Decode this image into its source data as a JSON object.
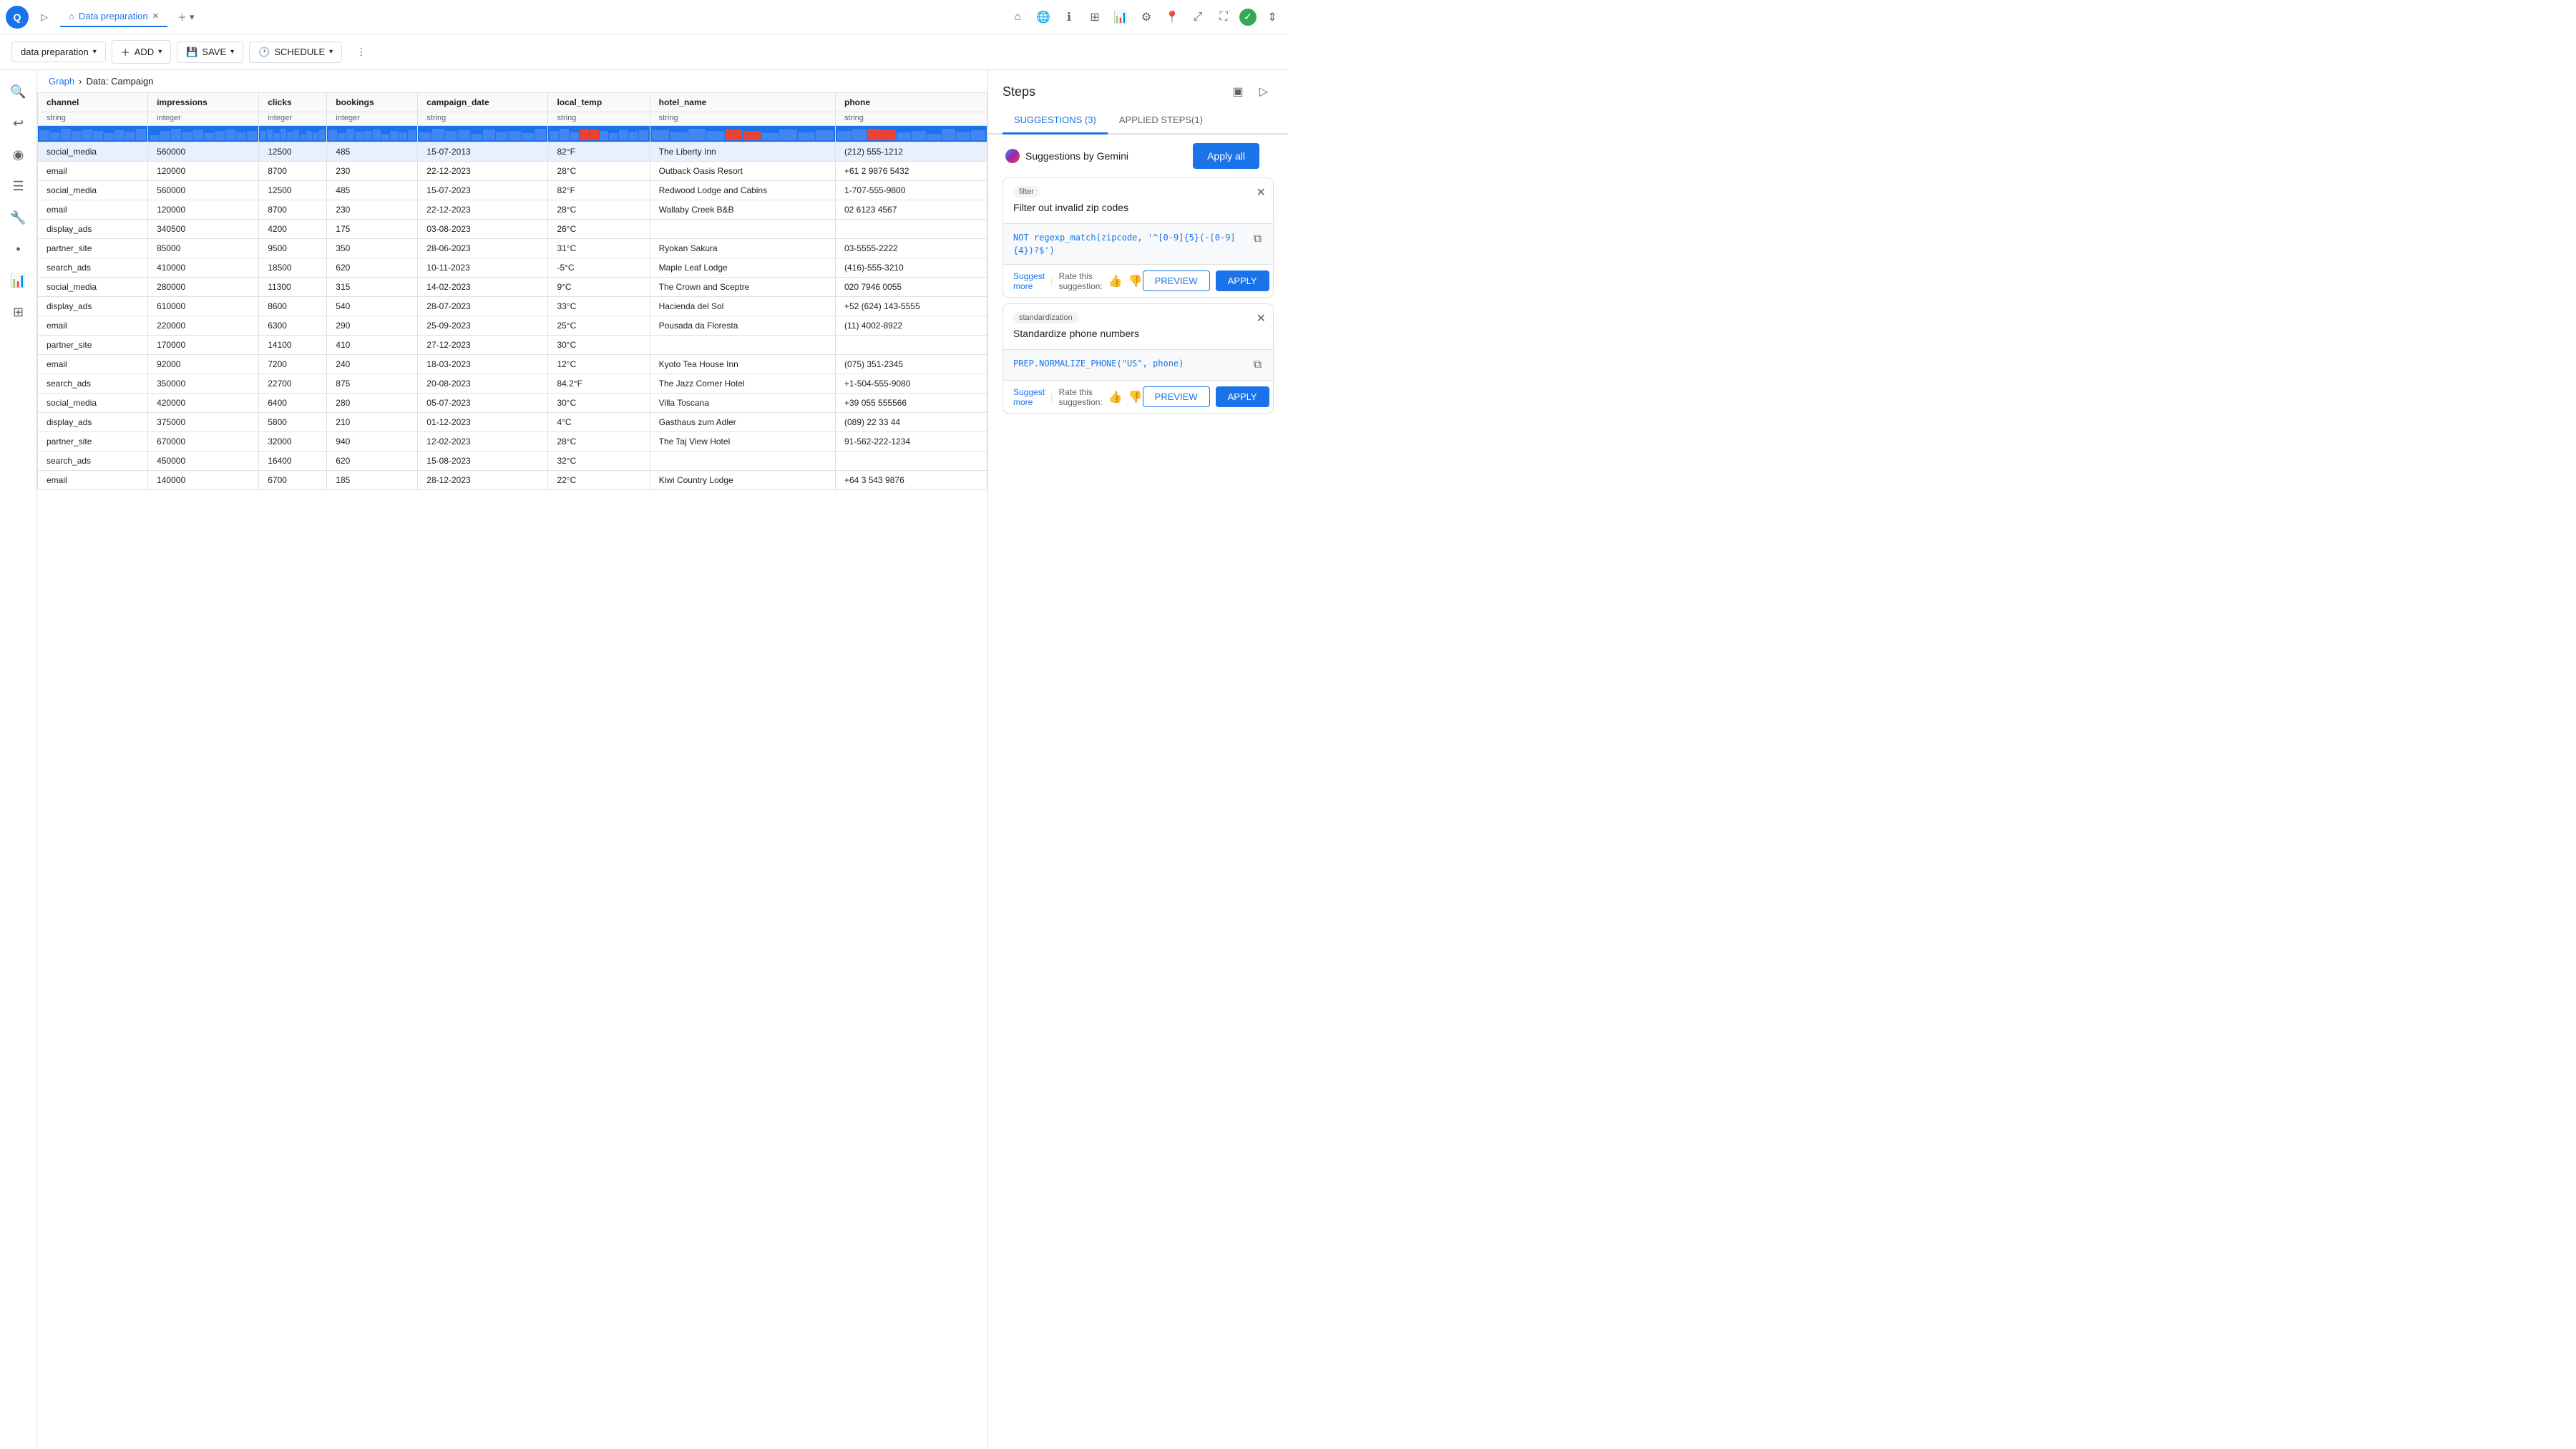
{
  "app": {
    "logo_text": "Q",
    "tab_label": "Data preparation",
    "add_btn": "ADD",
    "save_btn": "SAVE",
    "schedule_btn": "SCHEDULE"
  },
  "breadcrumb": {
    "graph": "Graph",
    "separator": "›",
    "current": "Data: Campaign"
  },
  "table": {
    "columns": [
      {
        "name": "channel",
        "type": "string"
      },
      {
        "name": "impressions",
        "type": "integer"
      },
      {
        "name": "clicks",
        "type": "integer"
      },
      {
        "name": "bookings",
        "type": "integer"
      },
      {
        "name": "campaign_date",
        "type": "string"
      },
      {
        "name": "local_temp",
        "type": "string"
      },
      {
        "name": "hotel_name",
        "type": "string"
      },
      {
        "name": "phone",
        "type": "string"
      }
    ],
    "rows": [
      [
        "social_media",
        "560000",
        "12500",
        "485",
        "15-07-2013",
        "82°F",
        "The Liberty Inn",
        "(212) 555-1212"
      ],
      [
        "email",
        "120000",
        "8700",
        "230",
        "22-12-2023",
        "28°C",
        "Outback Oasis Resort",
        "+61 2 9876 5432"
      ],
      [
        "social_media",
        "560000",
        "12500",
        "485",
        "15-07-2023",
        "82°F",
        "Redwood Lodge and Cabins",
        "1-707-555-9800"
      ],
      [
        "email",
        "120000",
        "8700",
        "230",
        "22-12-2023",
        "28°C",
        "Wallaby Creek B&B",
        "02 6123 4567"
      ],
      [
        "display_ads",
        "340500",
        "4200",
        "175",
        "03-08-2023",
        "26°C",
        "",
        ""
      ],
      [
        "partner_site",
        "85000",
        "9500",
        "350",
        "28-06-2023",
        "31°C",
        "Ryokan Sakura",
        "03-5555-2222"
      ],
      [
        "search_ads",
        "410000",
        "18500",
        "620",
        "10-11-2023",
        "-5°C",
        "Maple Leaf Lodge",
        "(416)-555-3210"
      ],
      [
        "social_media",
        "280000",
        "11300",
        "315",
        "14-02-2023",
        "9°C",
        "The Crown and Sceptre",
        "020 7946 0055"
      ],
      [
        "display_ads",
        "610000",
        "8600",
        "540",
        "28-07-2023",
        "33°C",
        "Hacienda del Sol",
        "+52 (624) 143-5555"
      ],
      [
        "email",
        "220000",
        "6300",
        "290",
        "25-09-2023",
        "25°C",
        "Pousada da Floresta",
        "(11) 4002-8922"
      ],
      [
        "partner_site",
        "170000",
        "14100",
        "410",
        "27-12-2023",
        "30°C",
        "",
        ""
      ],
      [
        "email",
        "92000",
        "7200",
        "240",
        "18-03-2023",
        "12°C",
        "Kyoto Tea House Inn",
        "(075) 351-2345"
      ],
      [
        "search_ads",
        "350000",
        "22700",
        "875",
        "20-08-2023",
        "84.2°F",
        "The Jazz Corner Hotel",
        "+1-504-555-9080"
      ],
      [
        "social_media",
        "420000",
        "6400",
        "280",
        "05-07-2023",
        "30°C",
        "Villa Toscana",
        "+39 055 555566"
      ],
      [
        "display_ads",
        "375000",
        "5800",
        "210",
        "01-12-2023",
        "4°C",
        "Gasthaus zum Adler",
        "(089) 22 33 44"
      ],
      [
        "partner_site",
        "670000",
        "32000",
        "940",
        "12-02-2023",
        "28°C",
        "The Taj View Hotel",
        "91-562-222-1234"
      ],
      [
        "search_ads",
        "450000",
        "16400",
        "620",
        "15-08-2023",
        "32°C",
        "",
        ""
      ],
      [
        "email",
        "140000",
        "6700",
        "185",
        "28-12-2023",
        "22°C",
        "Kiwi Country Lodge",
        "+64 3 543 9876"
      ]
    ]
  },
  "steps_panel": {
    "title": "Steps",
    "tab_suggestions": "SUGGESTIONS (3)",
    "tab_applied": "APPLIED STEPS(1)",
    "apply_all_label": "Apply all",
    "gemini_label": "Suggestions by Gemini",
    "suggestions": [
      {
        "tag": "filter",
        "title": "Filter out invalid zip codes",
        "code": "NOT regexp_match(zipcode, '^[0-9]{5}(-[0-9]{4})?$')",
        "rate_label": "Rate this suggestion:",
        "suggest_more": "Suggest more",
        "preview_label": "PREVIEW",
        "apply_label": "APPLY"
      },
      {
        "tag": "standardization",
        "title": "Standardize phone numbers",
        "code": "PREP.NORMALIZE_PHONE(\"US\", phone)",
        "rate_label": "Rate this suggestion:",
        "suggest_more": "Suggest more",
        "preview_label": "PREVIEW",
        "apply_label": "APPLY"
      }
    ]
  }
}
